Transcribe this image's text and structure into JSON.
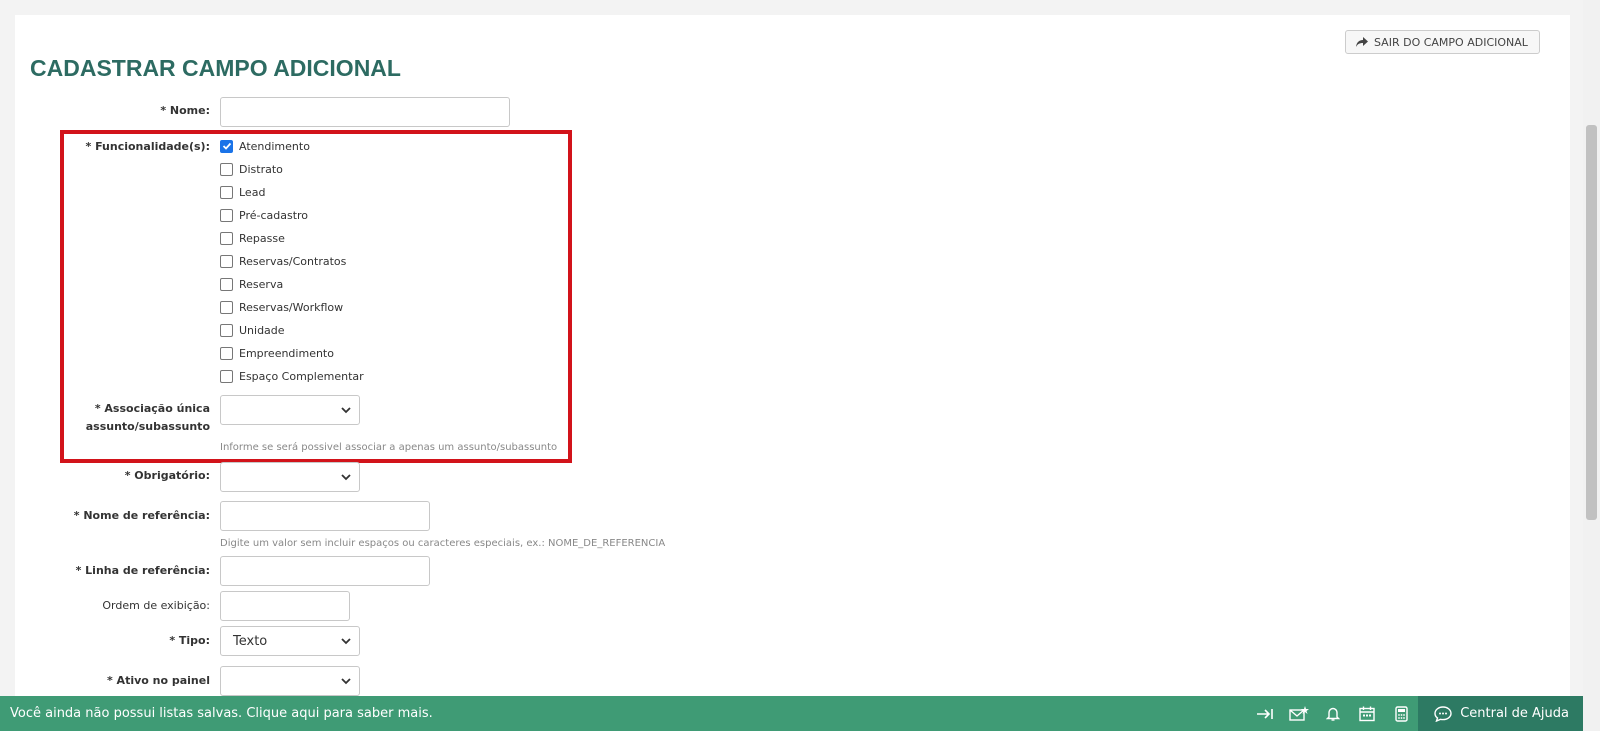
{
  "header": {
    "title": "CADASTRAR CAMPO ADICIONAL",
    "exit_label": "SAIR DO CAMPO ADICIONAL"
  },
  "form": {
    "nome_label": "* Nome:",
    "nome_value": "",
    "funcionalidades_label": "* Funcionalidade(s):",
    "funcionalidades": [
      {
        "label": "Atendimento",
        "checked": true
      },
      {
        "label": "Distrato",
        "checked": false
      },
      {
        "label": "Lead",
        "checked": false
      },
      {
        "label": "Pré-cadastro",
        "checked": false
      },
      {
        "label": "Repasse",
        "checked": false
      },
      {
        "label": "Reservas/Contratos",
        "checked": false
      },
      {
        "label": "Reserva",
        "checked": false
      },
      {
        "label": "Reservas/Workflow",
        "checked": false
      },
      {
        "label": "Unidade",
        "checked": false
      },
      {
        "label": "Empreendimento",
        "checked": false
      },
      {
        "label": "Espaço Complementar",
        "checked": false
      }
    ],
    "associacao_label_1": "* Associação única",
    "associacao_label_2": "assunto/subassunto",
    "associacao_value": "",
    "associacao_hint": "Informe se será possivel associar a apenas um assunto/subassunto",
    "obrigatorio_label": "* Obrigatório:",
    "obrigatorio_value": "",
    "nome_ref_label": "* Nome de referência:",
    "nome_ref_value": "",
    "nome_ref_hint": "Digite um valor sem incluir espaços ou caracteres especiais, ex.: NOME_DE_REFERENCIA",
    "linha_ref_label": "* Linha de referência:",
    "linha_ref_value": "",
    "ordem_label": "Ordem de exibição:",
    "ordem_value": "",
    "tipo_label": "* Tipo:",
    "tipo_value": "Texto",
    "ativo_label": "* Ativo no painel",
    "ativo_value": ""
  },
  "footer": {
    "message": "Você ainda não possui listas salvas. Clique aqui para saber mais.",
    "help_label": "Central de Ajuda",
    "icons": [
      "arrow-right-bar-icon",
      "mail-star-icon",
      "bell-icon",
      "calendar-icon",
      "calculator-icon"
    ]
  },
  "colors": {
    "title": "#2d6b62",
    "footer_bg": "#3f9b75",
    "help_bg": "#2d7a63",
    "highlight_border": "#d2131a",
    "checkbox_checked": "#1a73e8"
  }
}
